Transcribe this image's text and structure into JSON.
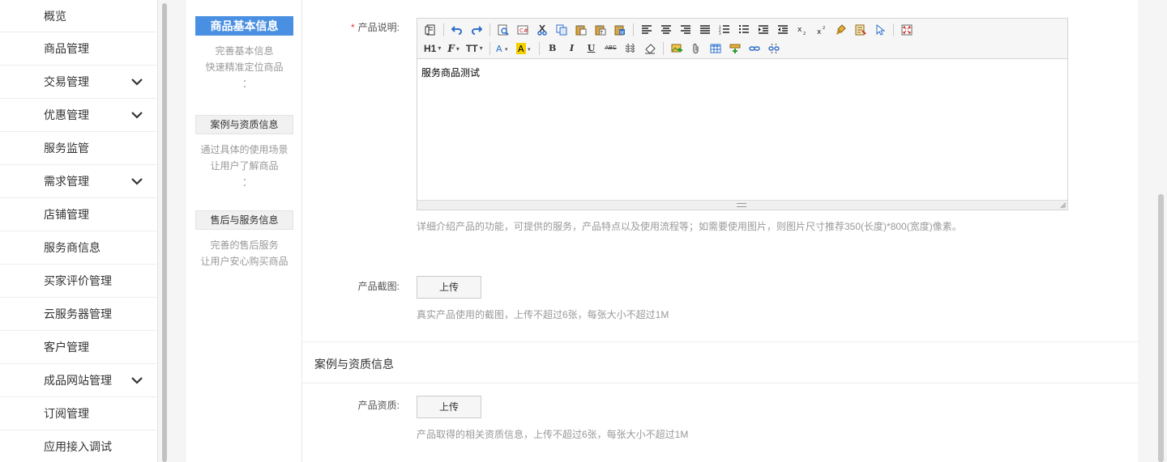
{
  "sidebar": {
    "items": [
      {
        "label": "概览",
        "expandable": false
      },
      {
        "label": "商品管理",
        "expandable": false
      },
      {
        "label": "交易管理",
        "expandable": true
      },
      {
        "label": "优惠管理",
        "expandable": true
      },
      {
        "label": "服务监管",
        "expandable": false
      },
      {
        "label": "需求管理",
        "expandable": true
      },
      {
        "label": "店铺管理",
        "expandable": false
      },
      {
        "label": "服务商信息",
        "expandable": false
      },
      {
        "label": "买家评价管理",
        "expandable": false
      },
      {
        "label": "云服务器管理",
        "expandable": false
      },
      {
        "label": "客户管理",
        "expandable": false
      },
      {
        "label": "成品网站管理",
        "expandable": true
      },
      {
        "label": "订阅管理",
        "expandable": false
      },
      {
        "label": "应用接入调试",
        "expandable": false
      }
    ]
  },
  "steps": {
    "step1": {
      "title": "商品基本信息",
      "desc1": "完善基本信息",
      "desc2": "快速精准定位商品"
    },
    "step2": {
      "title": "案例与资质信息",
      "desc1": "通过具体的使用场景",
      "desc2": "让用户了解商品"
    },
    "step3": {
      "title": "售后与服务信息",
      "desc1": "完善的售后服务",
      "desc2": "让用户安心购买商品"
    }
  },
  "form": {
    "description": {
      "required_mark": "*",
      "label": "产品说明:",
      "content": "服务商品测试",
      "hint": "详细介绍产品的功能，可提供的服务，产品特点以及使用流程等；如需要使用图片，则图片尺寸推荐350(长度)*800(宽度)像素。"
    },
    "screenshot": {
      "label": "产品截图:",
      "button": "上传",
      "hint": "真实产品使用的截图，上传不超过6张，每张大小不超过1M"
    },
    "section2_title": "案例与资质信息",
    "qualification": {
      "label": "产品资质:",
      "button": "上传",
      "hint": "产品取得的相关资质信息，上传不超过6张，每张大小不超过1M"
    }
  },
  "toolbar": {
    "heading": "H1",
    "font": "F",
    "size": "TT",
    "bold": "B",
    "italic": "I",
    "underline": "U",
    "strike": "ABC"
  },
  "colors": {
    "accent": "#4a90e2",
    "required": "#e4393c"
  }
}
